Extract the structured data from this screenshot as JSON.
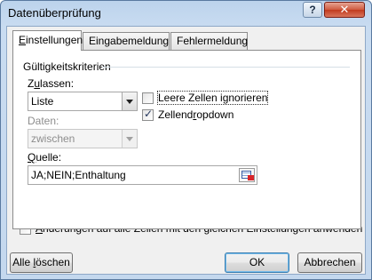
{
  "window": {
    "title": "Datenüberprüfung",
    "help_label": "?",
    "close_label": "✕"
  },
  "tabs": [
    {
      "label": "Einstellungen",
      "underline_char": "E",
      "rest": "instellungen",
      "active": true
    },
    {
      "label": "Eingabemeldung",
      "active": false
    },
    {
      "label": "Fehlermeldung",
      "active": false
    }
  ],
  "criteria": {
    "group_title": "Gültigkeitskriterien",
    "allow_label_pre": "Z",
    "allow_label_u": "u",
    "allow_label_post": "lassen:",
    "allow_value": "Liste",
    "data_label": "Daten:",
    "data_value": "zwischen",
    "ignore_blank_label": "Leere Zellen ignorieren",
    "ignore_blank_checked": false,
    "dropdown_label_pre": "Zellend",
    "dropdown_label_u": "r",
    "dropdown_label_post": "opdown",
    "dropdown_checked": true,
    "source_label_pre": "",
    "source_label_u": "Q",
    "source_label_post": "uelle:",
    "source_value": "JA;NEIN;Enthaltung",
    "apply_all_label_u": "Ä",
    "apply_all_label_post": "nderungen auf alle Zellen mit den gleichen Einstellungen anwenden",
    "apply_all_checked": false
  },
  "buttons": {
    "clear_pre": "Alle ",
    "clear_u": "l",
    "clear_post": "öschen",
    "ok": "OK",
    "cancel": "Abbrechen"
  }
}
